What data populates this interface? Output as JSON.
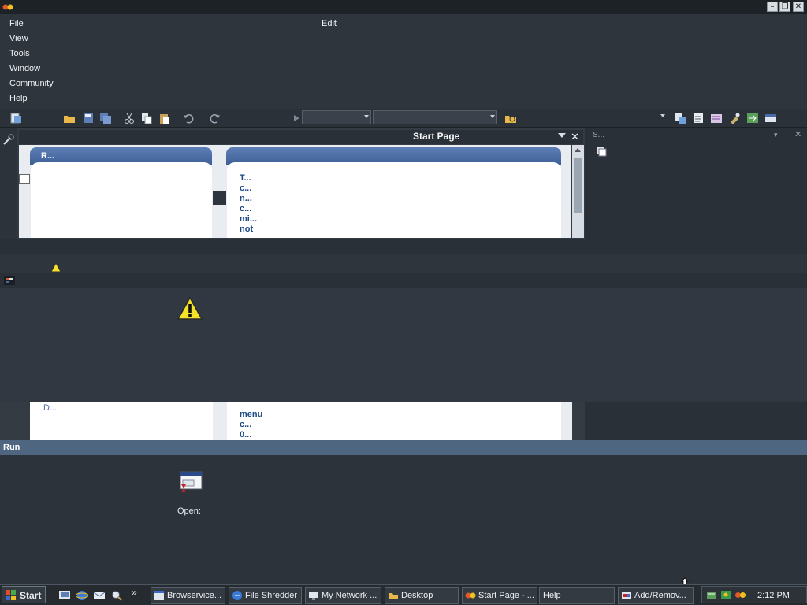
{
  "menu": {
    "items": [
      "File",
      "View",
      "Tools",
      "Window",
      "Community",
      "Help"
    ],
    "edit_label": "Edit"
  },
  "start_page": {
    "title": "Start Page",
    "recent_header": "R...",
    "news_links": [
      "T...",
      "c...",
      "n...",
      "c...",
      "mi...",
      "not"
    ],
    "lower_left_text": "D...",
    "lower_links": [
      "menu",
      "c...",
      "0..."
    ]
  },
  "right_pane": {
    "title": "S..."
  },
  "run": {
    "title": "Run",
    "open_label": "Open:"
  },
  "taskbar": {
    "start_label": "Start",
    "windows": [
      "Browservice...",
      "File Shredder",
      "My Network ...",
      "Desktop",
      "Start Page - ...",
      "Help",
      "Add/Remov..."
    ],
    "clock": "2:12 PM"
  },
  "colors": {
    "accent": "#4f6680",
    "panel_header": "#4a6aa5",
    "link": "#1d4a86"
  }
}
